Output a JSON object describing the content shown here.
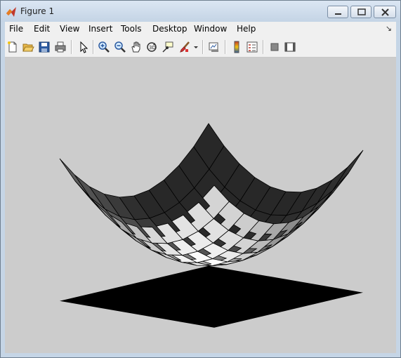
{
  "window": {
    "title": "Figure 1",
    "minimize_label": "minimize",
    "maximize_label": "maximize",
    "close_label": "close"
  },
  "menu": {
    "items": [
      {
        "label": "File"
      },
      {
        "label": "Edit"
      },
      {
        "label": "View"
      },
      {
        "label": "Insert"
      },
      {
        "label": "Tools"
      },
      {
        "label": "Desktop"
      },
      {
        "label": "Window"
      },
      {
        "label": "Help"
      }
    ],
    "dock_arrow": "↘"
  },
  "toolbar": {
    "buttons": [
      {
        "icon": "new-figure-icon"
      },
      {
        "icon": "open-file-icon"
      },
      {
        "icon": "save-icon"
      },
      {
        "icon": "print-icon"
      },
      {
        "icon": "edit-plot-arrow-icon"
      },
      {
        "icon": "zoom-in-icon"
      },
      {
        "icon": "zoom-out-icon"
      },
      {
        "icon": "pan-hand-icon"
      },
      {
        "icon": "rotate-3d-icon"
      },
      {
        "icon": "data-cursor-icon"
      },
      {
        "icon": "brush-icon"
      },
      {
        "icon": "brush-dropdown-icon"
      },
      {
        "icon": "link-plot-icon"
      },
      {
        "icon": "insert-colorbar-icon"
      },
      {
        "icon": "insert-legend-icon"
      },
      {
        "icon": "hide-plot-tools-icon"
      },
      {
        "icon": "show-plot-tools-icon"
      }
    ]
  },
  "colors": {
    "title_gradient_top": "#dbe6f3",
    "figure_background": "#cccccc",
    "shadow": "#000000"
  },
  "plot": {
    "type": "surface",
    "colormap": "gray",
    "description_note": "",
    "grid_points": 11,
    "x_range": [
      -1,
      1
    ],
    "y_range": [
      -1,
      1
    ]
  }
}
